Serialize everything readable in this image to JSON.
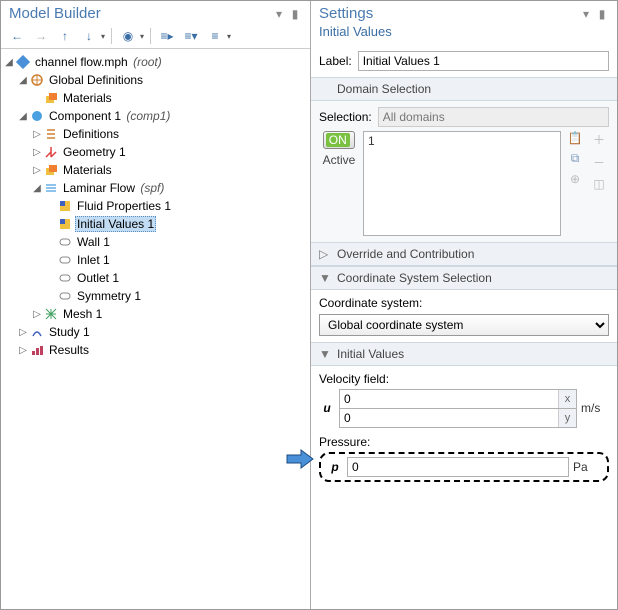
{
  "left": {
    "title": "Model Builder",
    "tree": {
      "root": {
        "label": "channel flow.mph",
        "suffix": "(root)"
      },
      "globalDefs": "Global Definitions",
      "materialsG": "Materials",
      "comp1": {
        "label": "Component 1",
        "suffix": "(comp1)"
      },
      "defs": "Definitions",
      "geom": "Geometry 1",
      "materialsC": "Materials",
      "laminar": {
        "label": "Laminar Flow",
        "suffix": "(spf)"
      },
      "fluid": "Fluid Properties 1",
      "initvals": "Initial Values 1",
      "wall": "Wall 1",
      "inlet": "Inlet 1",
      "outlet": "Outlet 1",
      "symmetry": "Symmetry 1",
      "mesh": "Mesh 1",
      "study": "Study 1",
      "results": "Results"
    }
  },
  "right": {
    "title": "Settings",
    "subtitle": "Initial Values",
    "labelField": {
      "label": "Label:",
      "value": "Initial Values 1"
    },
    "sections": {
      "domain": "Domain Selection",
      "override": "Override and Contribution",
      "coord": "Coordinate System Selection",
      "initvals": "Initial Values"
    },
    "domain": {
      "selLabel": "Selection:",
      "selValue": "All domains",
      "active": "Active",
      "on": "ON",
      "listValue": "1"
    },
    "coord": {
      "label": "Coordinate system:",
      "value": "Global coordinate system"
    },
    "iv": {
      "velLabel": "Velocity field:",
      "velSym": "u",
      "vx": "0",
      "vy": "0",
      "axX": "x",
      "axY": "y",
      "velUnit": "m/s",
      "presLabel": "Pressure:",
      "presSym": "p",
      "presVal": "0",
      "presUnit": "Pa"
    }
  }
}
